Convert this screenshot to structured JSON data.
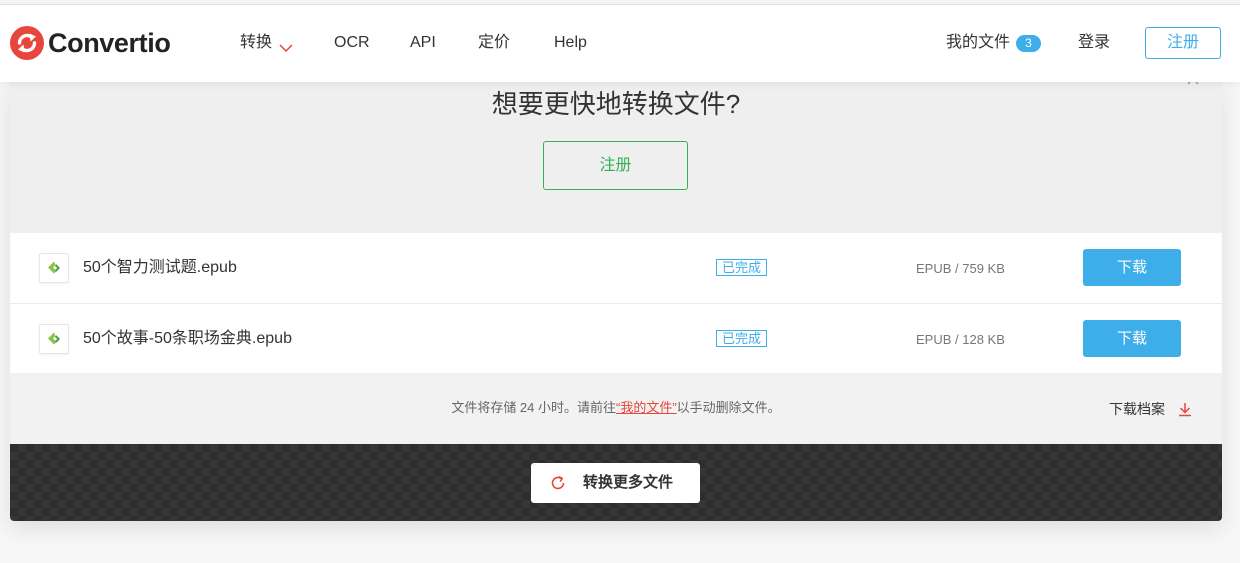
{
  "header": {
    "logo": {
      "text": "Convertio",
      "icon": "convertio-logo-icon"
    },
    "nav": [
      {
        "label": "转换",
        "dropdown_icon": "chevron-down-icon"
      },
      {
        "label": "OCR"
      },
      {
        "label": "API"
      },
      {
        "label": "定价"
      },
      {
        "label": "Help"
      }
    ],
    "my_files": {
      "label": "我的文件",
      "count": "3"
    },
    "login_label": "登录",
    "register_label": "注册"
  },
  "promo": {
    "title": "想要更快地转换文件?",
    "register_label": "注册",
    "close_icon": "close-icon"
  },
  "files": [
    {
      "name": "50个智力测试题.epub",
      "icon": "epub-file-icon",
      "status": "已完成",
      "format_size": "EPUB / 759 KB",
      "download_label": "下载"
    },
    {
      "name": "50个故事-50条职场金典.epub",
      "icon": "epub-file-icon",
      "status": "已完成",
      "format_size": "EPUB / 128 KB",
      "download_label": "下载"
    }
  ],
  "notice": {
    "text_before": "文件将存储 24 小时。请前往",
    "link_text": "“我的文件”",
    "text_after": "以手动删除文件。"
  },
  "download_archive": {
    "label": "下载档案",
    "icon": "download-arrow-icon"
  },
  "convert_more": {
    "label": "转换更多文件",
    "icon": "refresh-icon"
  },
  "colors": {
    "brand_red": "#e8453c",
    "accent_blue": "#3daee9",
    "success_green": "#34b251",
    "dark_bar": "#333333"
  }
}
